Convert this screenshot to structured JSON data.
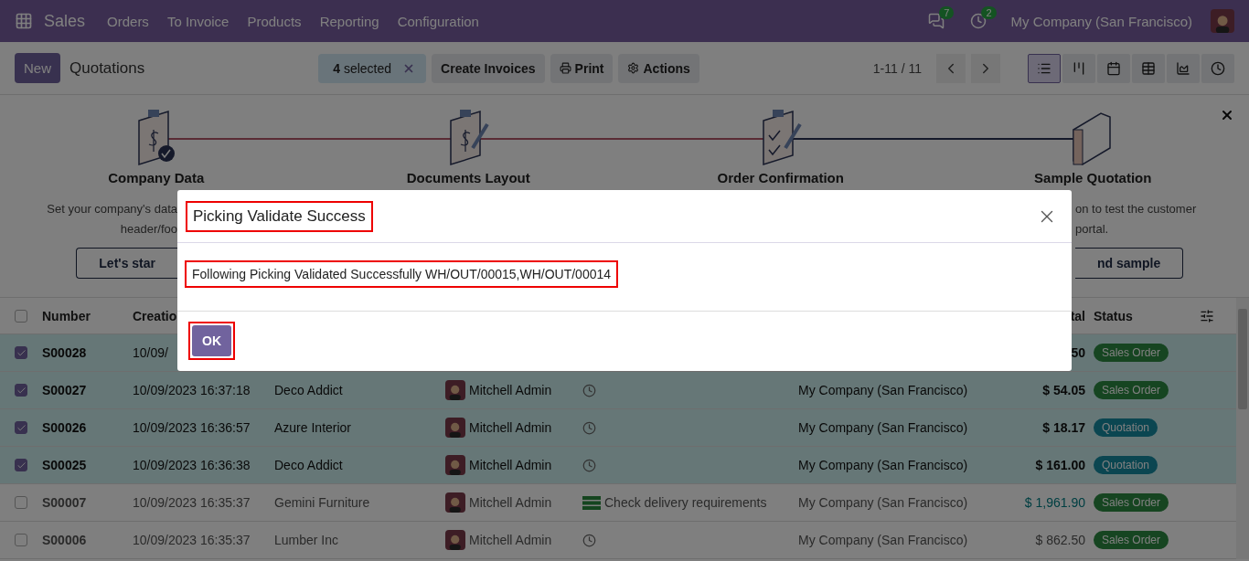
{
  "navbar": {
    "app": "Sales",
    "menu": [
      "Orders",
      "To Invoice",
      "Products",
      "Reporting",
      "Configuration"
    ],
    "messages_count": "7",
    "activities_count": "2",
    "company": "My Company (San Francisco)"
  },
  "control_panel": {
    "new_button": "New",
    "title": "Quotations",
    "selection": "**4** selected",
    "actions": [
      {
        "kind": "plain",
        "label": "Create Invoices"
      },
      {
        "kind": "print",
        "label": "Print"
      },
      {
        "kind": "gear",
        "label": "Actions"
      }
    ],
    "pager": "1-11 / 11",
    "views": [
      {
        "kind": "list",
        "selected": true
      },
      {
        "kind": "kanban",
        "selected": false
      },
      {
        "kind": "calendar",
        "selected": false
      },
      {
        "kind": "pivot",
        "selected": false
      },
      {
        "kind": "graph",
        "selected": false
      },
      {
        "kind": "activity",
        "selected": false
      }
    ]
  },
  "onboarding": {
    "steps": [
      {
        "kind": "company",
        "done": true,
        "title": "Company Data",
        "lines": [
          "Set your company's data",
          "header/foo"
        ],
        "button": "Let's star"
      },
      {
        "kind": "layout",
        "done": false,
        "title": "Documents Layout"
      },
      {
        "kind": "confirmation",
        "done": false,
        "title": "Order Confirmation"
      },
      {
        "kind": "sample",
        "done": false,
        "title": "Sample Quotation",
        "lines": [
          "on to test the customer",
          "portal."
        ],
        "button": "nd sample"
      }
    ]
  },
  "table": {
    "all_selected": false,
    "header": {
      "number": "Number",
      "created": "Creatio",
      "total": "tal",
      "status": "Status"
    },
    "rows": [
      {
        "selected": true,
        "number": "S00028",
        "created": "10/09/",
        "total": "50",
        "total_highlighted": false,
        "status": {
          "kind": "sale",
          "label": "Sales Order"
        }
      },
      {
        "selected": true,
        "number": "S00027",
        "created": "10/09/2023 16:37:18",
        "customer": "Deco Addict",
        "salesperson": "Mitchell Admin",
        "activity": {
          "kind": "clock"
        },
        "company": "My Company (San Francisco)",
        "total": "$ 54.05",
        "total_highlighted": false,
        "status": {
          "kind": "sale",
          "label": "Sales Order"
        }
      },
      {
        "selected": true,
        "number": "S00026",
        "created": "10/09/2023 16:36:57",
        "customer": "Azure Interior",
        "salesperson": "Mitchell Admin",
        "activity": {
          "kind": "clock"
        },
        "company": "My Company (San Francisco)",
        "total": "$ 18.17",
        "total_highlighted": false,
        "status": {
          "kind": "quotation",
          "label": "Quotation"
        }
      },
      {
        "selected": true,
        "number": "S00025",
        "created": "10/09/2023 16:36:38",
        "customer": "Deco Addict",
        "salesperson": "Mitchell Admin",
        "activity": {
          "kind": "clock"
        },
        "company": "My Company (San Francisco)",
        "total": "$ 161.00",
        "total_highlighted": false,
        "status": {
          "kind": "quotation",
          "label": "Quotation"
        }
      },
      {
        "selected": false,
        "number": "S00007",
        "created": "10/09/2023 16:35:37",
        "customer": "Gemini Furniture",
        "salesperson": "Mitchell Admin",
        "activity": {
          "kind": "todo",
          "text": "Check delivery requirements"
        },
        "company": "My Company (San Francisco)",
        "total": "$ 1,961.90",
        "total_highlighted": true,
        "status": {
          "kind": "sale",
          "label": "Sales Order"
        }
      },
      {
        "selected": false,
        "number": "S00006",
        "created": "10/09/2023 16:35:37",
        "customer": "Lumber Inc",
        "salesperson": "Mitchell Admin",
        "activity": {
          "kind": "clock"
        },
        "company": "My Company (San Francisco)",
        "total": "$ 862.50",
        "total_highlighted": false,
        "status": {
          "kind": "sale",
          "label": "Sales Order"
        }
      }
    ]
  },
  "dialog": {
    "title": "Picking Validate Success",
    "message": "Following Picking Validated Successfully WH/OUT/00015,WH/OUT/00014",
    "button": "OK"
  }
}
